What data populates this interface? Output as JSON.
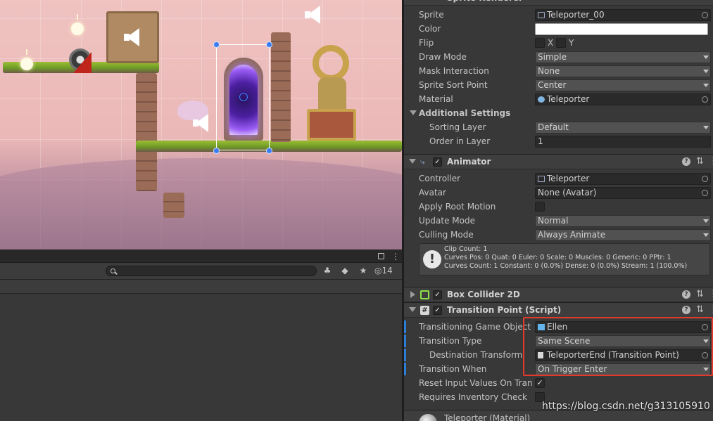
{
  "inspector": {
    "sprite_renderer": {
      "title": "Sprite Renderer",
      "sprite_label": "Sprite",
      "sprite_value": "Teleporter_00",
      "color_label": "Color",
      "flip_label": "Flip",
      "flip_x": "X",
      "flip_y": "Y",
      "draw_mode_label": "Draw Mode",
      "draw_mode_value": "Simple",
      "mask_label": "Mask Interaction",
      "mask_value": "None",
      "sort_point_label": "Sprite Sort Point",
      "sort_point_value": "Center",
      "material_label": "Material",
      "material_value": "Teleporter",
      "additional_label": "Additional Settings",
      "sorting_layer_label": "Sorting Layer",
      "sorting_layer_value": "Default",
      "order_label": "Order in Layer",
      "order_value": "1"
    },
    "animator": {
      "title": "Animator",
      "controller_label": "Controller",
      "controller_value": "Teleporter",
      "avatar_label": "Avatar",
      "avatar_value": "None (Avatar)",
      "root_motion_label": "Apply Root Motion",
      "update_label": "Update Mode",
      "update_value": "Normal",
      "culling_label": "Culling Mode",
      "culling_value": "Always Animate",
      "info_lines": [
        "Clip Count: 1",
        "Curves Pos: 0 Quat: 0 Euler: 0 Scale: 0 Muscles: 0 Generic: 0 PPtr: 1",
        "Curves Count: 1 Constant: 0 (0.0%) Dense: 0 (0.0%) Stream: 1 (100.0%)"
      ]
    },
    "box_collider": {
      "title": "Box Collider 2D"
    },
    "transition_point": {
      "title": "Transition Point (Script)",
      "go_label": "Transitioning Game Object",
      "go_value": "Ellen",
      "type_label": "Transition Type",
      "type_value": "Same Scene",
      "dest_label": "Destination Transform",
      "dest_value": "TeleporterEnd (Transition Point)",
      "when_label": "Transition When",
      "when_value": "On Trigger Enter",
      "reset_label": "Reset Input Values On Transition",
      "inventory_label": "Requires Inventory Check"
    },
    "material_footer": "Teleporter (Material)"
  },
  "hierarchy": {
    "visible_count": "14"
  },
  "watermark": "https://blog.csdn.net/g313105910",
  "colors": {
    "highlight": "#e23b2e",
    "accent_blue": "#2a7fd6",
    "portal": "#9b5df6"
  }
}
